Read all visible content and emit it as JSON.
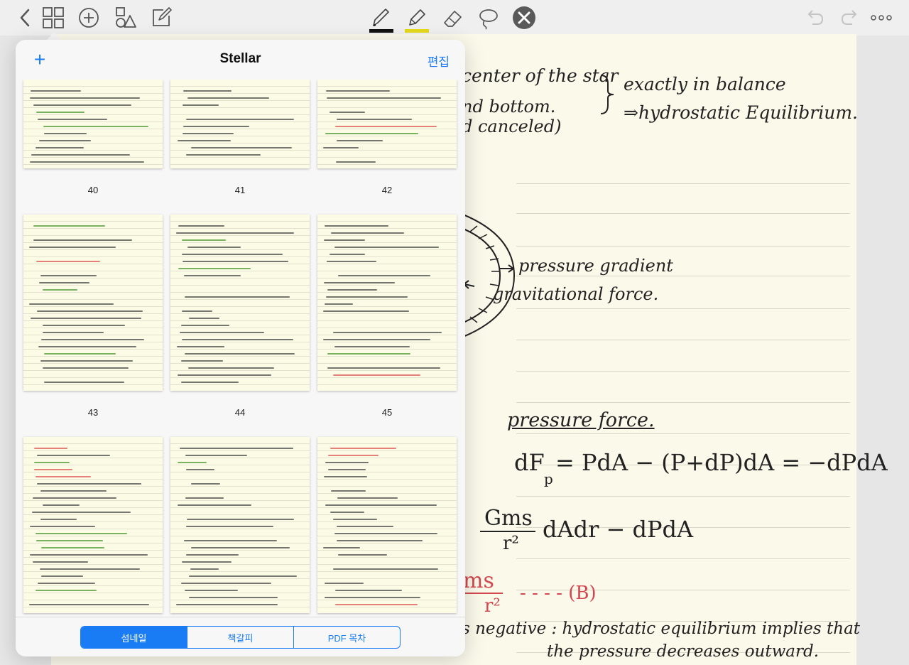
{
  "toolbar": {
    "left_tools": [
      "back-icon",
      "thumbnail-grid-icon",
      "add-page-icon",
      "shapes-icon",
      "compose-icon"
    ],
    "drawing_tools": [
      "pen-icon",
      "highlighter-icon",
      "eraser-icon",
      "lasso-icon",
      "close-tools-icon"
    ],
    "right_tools": [
      "undo-icon",
      "redo-icon",
      "more-icon"
    ],
    "pen_color": "#111111",
    "highlighter_color": "#e4d91b"
  },
  "note": {
    "lines": [
      "center of the star",
      "nd  bottom.",
      "d  canceled)",
      "exactly  in  balance",
      "⇒hydrostatic  Equilibrium.",
      "pressure  gradient",
      "gravitational force.",
      "pressure  force.",
      "dF",
      "p",
      "= PdA − (P+dP)dA = −dPdA",
      "Gms",
      "r²",
      "dAdr  −  dPdA",
      "ms",
      "r²",
      "- - - - (B)",
      "s  negative : hydrostatic  equilibrium  implies  that",
      "the  pressure  decreases  outward."
    ]
  },
  "popover": {
    "title": "Stellar",
    "add_icon": "+",
    "edit_label": "편집",
    "thumbnails": [
      {
        "page": "40"
      },
      {
        "page": "41"
      },
      {
        "page": "42"
      },
      {
        "page": "43"
      },
      {
        "page": "44"
      },
      {
        "page": "45"
      },
      {
        "page": ""
      },
      {
        "page": ""
      },
      {
        "page": ""
      }
    ],
    "tabs": [
      "섬네일",
      "책갈피",
      "PDF 목차"
    ],
    "active_tab": "섬네일"
  }
}
